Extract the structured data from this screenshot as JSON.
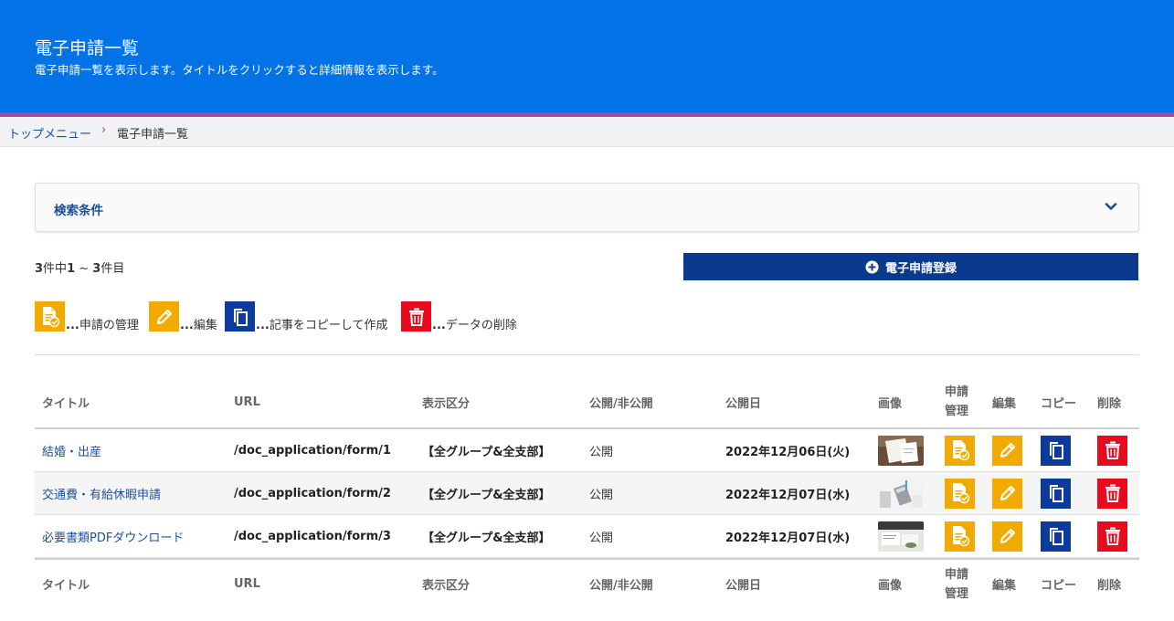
{
  "header": {
    "title": "電子申請一覧",
    "subtitle": "電子申請一覧を表示します。タイトルをクリックすると詳細情報を表示します。"
  },
  "breadcrumb": {
    "top": "トップメニュー",
    "separator": "›",
    "current": "電子申請一覧"
  },
  "search": {
    "label": "検索条件",
    "toggle_icon": "chevron-down-icon"
  },
  "result": {
    "total": "3",
    "text_a": "件中",
    "from": "1",
    "text_b": " ~ ",
    "to": "3",
    "text_c": "件目"
  },
  "register_button": {
    "label": "電子申請登録",
    "icon": "plus-circle-icon"
  },
  "legend": {
    "dots": "...",
    "manage": "申請の管理",
    "edit": "編集",
    "copy": "記事をコピーして作成",
    "delete": "データの削除"
  },
  "table": {
    "headers": {
      "title": "タイトル",
      "url": "URL",
      "display": "表示区分",
      "publish": "公開/非公開",
      "date": "公開日",
      "image": "画像",
      "manage_1": "申請",
      "manage_2": "管理",
      "edit": "編集",
      "copy": "コピー",
      "delete": "削除"
    },
    "rows": [
      {
        "title": "結婚・出産",
        "url": "/doc_application/form/1",
        "display": "【全グループ&全支部】",
        "publish": "公開",
        "date": "2022年12月06日(火)"
      },
      {
        "title": "交通費・有給休暇申請",
        "url": "/doc_application/form/2",
        "display": "【全グループ&全支部】",
        "publish": "公開",
        "date": "2022年12月07日(水)"
      },
      {
        "title": "必要書類PDFダウンロード",
        "url": "/doc_application/form/3",
        "display": "【全グループ&全支部】",
        "publish": "公開",
        "date": "2022年12月07日(水)"
      }
    ]
  },
  "colors": {
    "header_bg": "#0273e6",
    "stripe": "#9b4fa8",
    "primary_btn": "#0a3a8c",
    "manage_icon": "#f1ab00",
    "edit_icon": "#f1ab00",
    "copy_icon": "#0c3a9d",
    "delete_icon": "#ea0a1e",
    "link": "#1b4f9c"
  }
}
